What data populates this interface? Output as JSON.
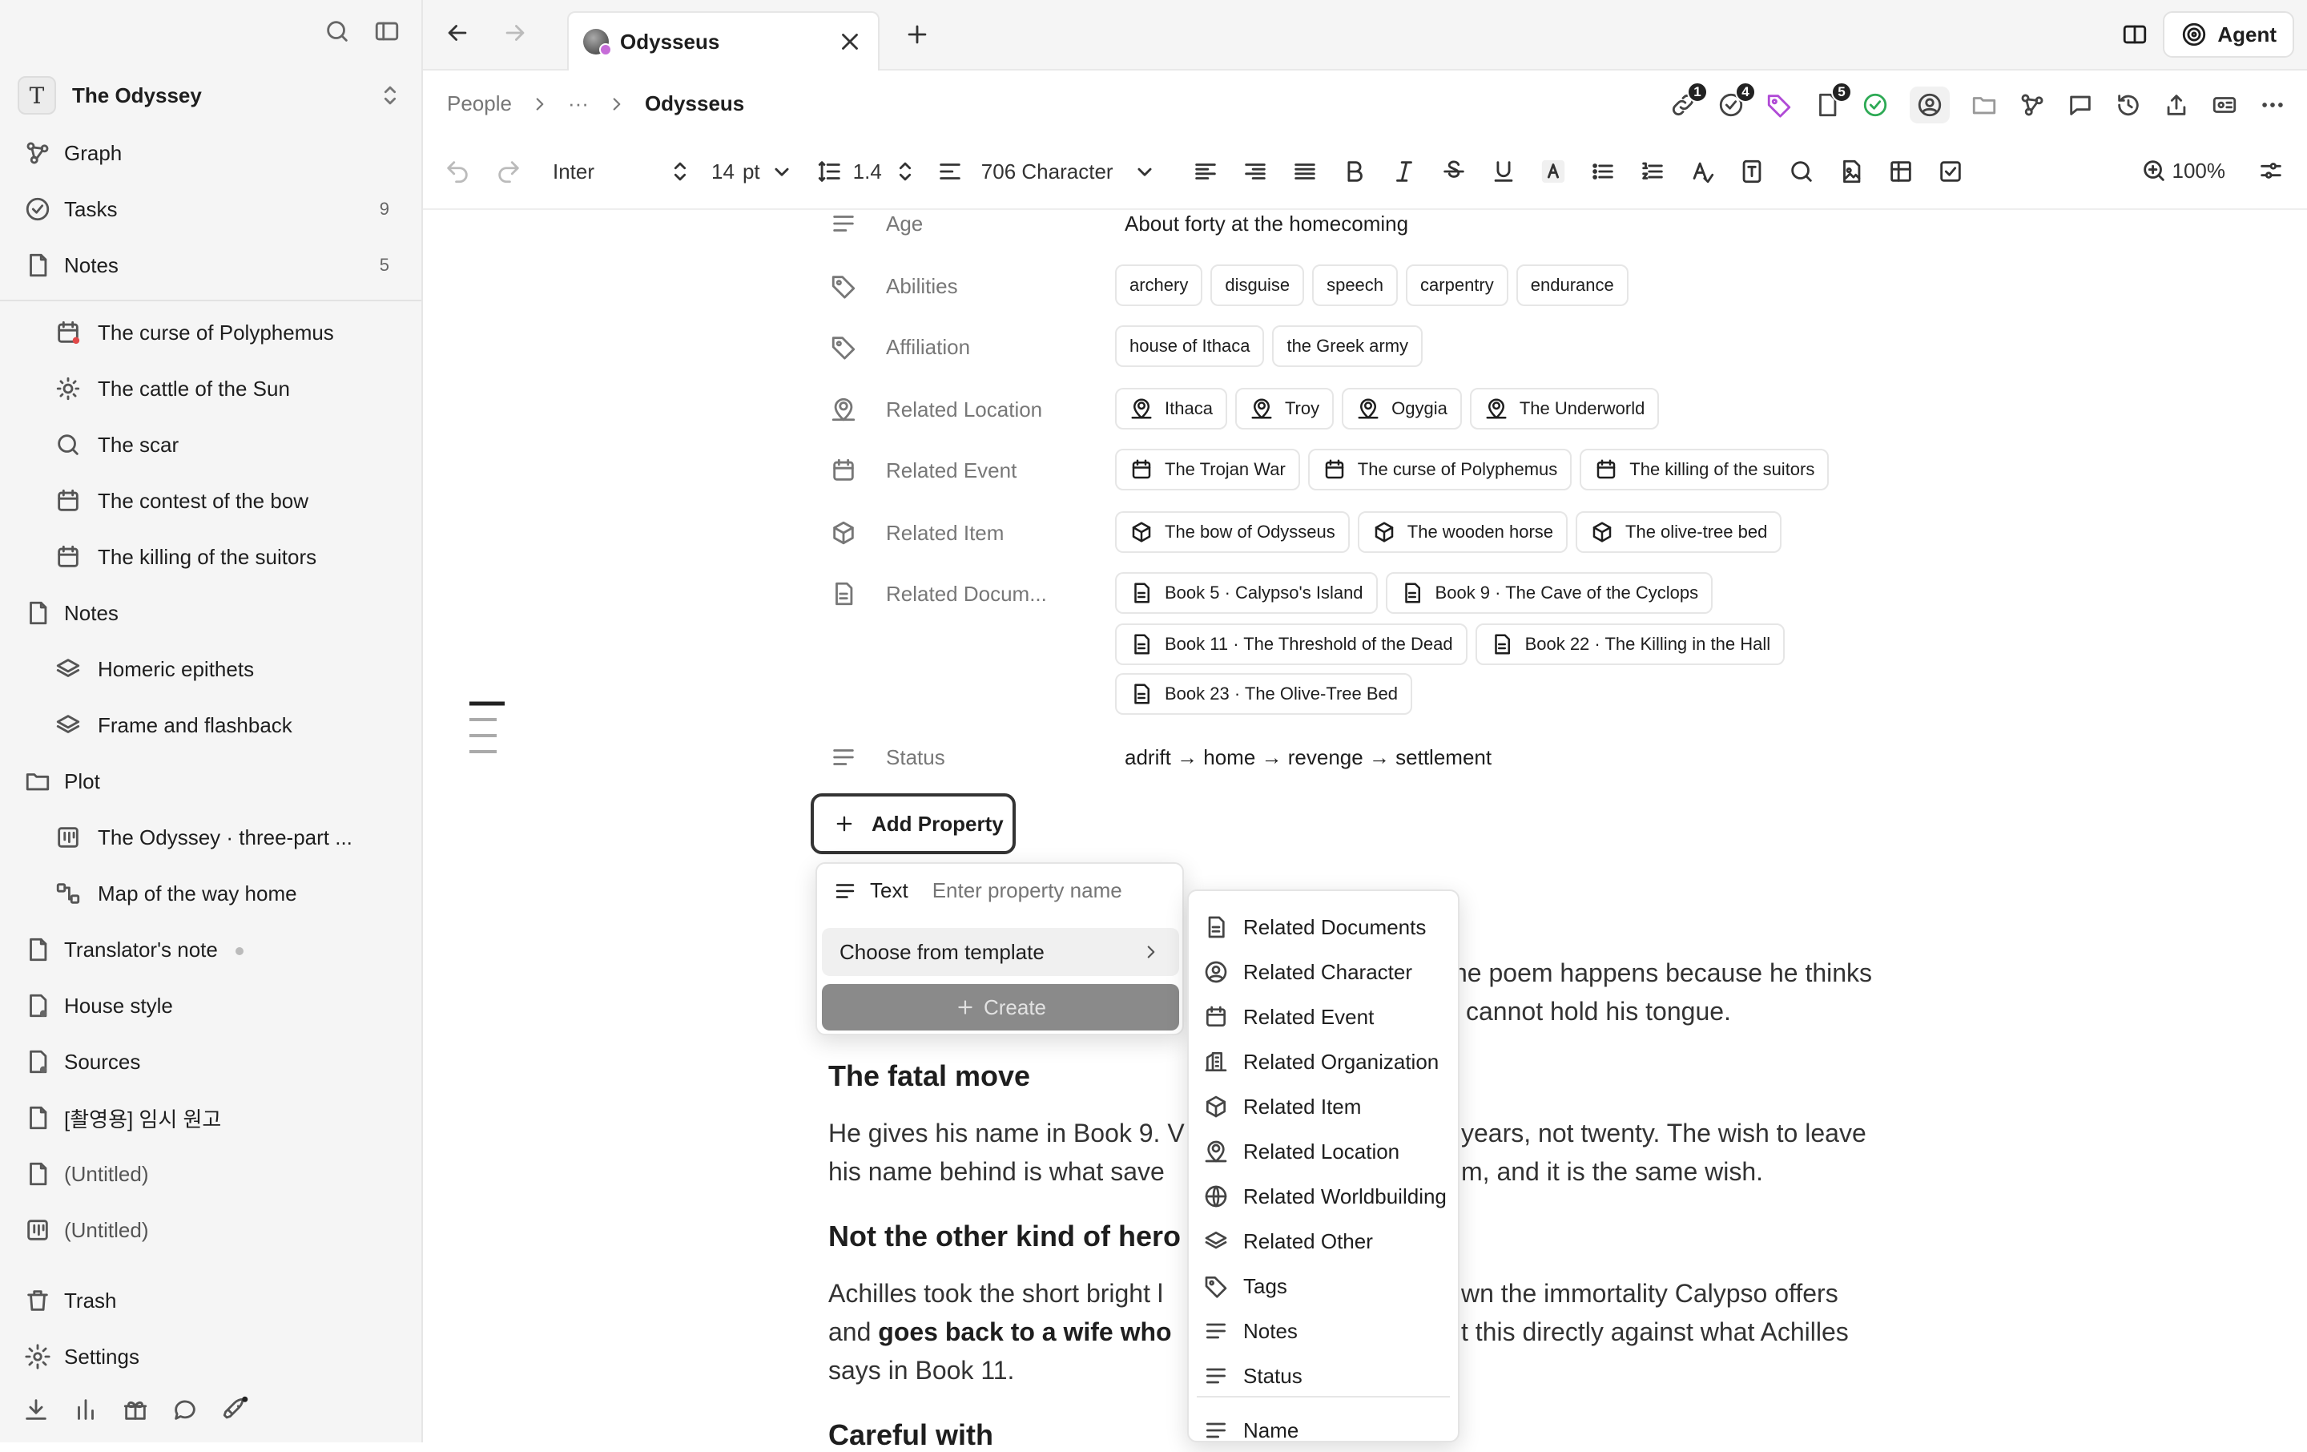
{
  "workspace": {
    "initial": "T",
    "name": "The Odyssey"
  },
  "sidebar": {
    "top": [
      {
        "label": "Graph",
        "icon": "graph-icon",
        "count": ""
      },
      {
        "label": "Tasks",
        "icon": "task-circle-icon",
        "count": "9"
      },
      {
        "label": "Notes",
        "icon": "page-icon",
        "count": "5"
      }
    ],
    "items": [
      {
        "label": "The curse of Polyphemus",
        "icon": "calendar-icon",
        "sub": true
      },
      {
        "label": "The cattle of the Sun",
        "icon": "sun-icon",
        "sub": true
      },
      {
        "label": "The scar",
        "icon": "search-icon",
        "sub": true
      },
      {
        "label": "The contest of the bow",
        "icon": "calendar-icon",
        "sub": true
      },
      {
        "label": "The killing of the suitors",
        "icon": "calendar-icon",
        "sub": true
      },
      {
        "label": "Notes",
        "icon": "page-icon",
        "sub": false
      },
      {
        "label": "Homeric epithets",
        "icon": "layers-icon",
        "sub": true
      },
      {
        "label": "Frame and flashback",
        "icon": "layers-icon",
        "sub": true
      },
      {
        "label": "Plot",
        "icon": "folder-icon",
        "sub": false
      },
      {
        "label": "The Odyssey · three-part ...",
        "icon": "board-icon",
        "sub": true
      },
      {
        "label": "Map of the way home",
        "icon": "map-icon",
        "sub": true
      },
      {
        "label": "Translator's note",
        "icon": "page-icon",
        "sub": false
      },
      {
        "label": "House style",
        "icon": "page-user-icon",
        "sub": false
      },
      {
        "label": "Sources",
        "icon": "page-user-icon",
        "sub": false
      },
      {
        "label": "[촬영용] 임시 원고",
        "icon": "page-icon",
        "sub": false
      },
      {
        "label": "(Untitled)",
        "icon": "page-icon",
        "sub": false
      },
      {
        "label": "(Untitled)",
        "icon": "board-icon",
        "sub": false
      }
    ],
    "trash": "Trash",
    "settings": "Settings"
  },
  "tab": {
    "title": "Odysseus"
  },
  "agent_label": "Agent",
  "breadcrumb": {
    "root": "People",
    "ellipsis": "···",
    "current": "Odysseus"
  },
  "badges": {
    "links": "1",
    "tasks": "4",
    "pages": "5"
  },
  "toolbar": {
    "font": "Inter",
    "size": "14",
    "unit": "pt",
    "line_height": "1.4",
    "template": "706 Character",
    "zoom": "100%"
  },
  "properties": {
    "age_label": "Age",
    "age_value": "About forty at the homecoming",
    "abilities_label": "Abilities",
    "abilities": [
      "archery",
      "disguise",
      "speech",
      "carpentry",
      "endurance"
    ],
    "affiliation_label": "Affiliation",
    "affiliations": [
      "house of Ithaca",
      "the Greek army"
    ],
    "location_label": "Related Location",
    "locations": [
      "Ithaca",
      "Troy",
      "Ogygia",
      "The Underworld"
    ],
    "event_label": "Related Event",
    "events": [
      "The Trojan War",
      "The curse of Polyphemus",
      "The killing of the suitors"
    ],
    "item_label": "Related Item",
    "items": [
      "The bow of Odysseus",
      "The wooden horse",
      "The olive-tree bed"
    ],
    "docs_label": "Related Docum...",
    "docs_row1": [
      "Book 5 · Calypso's Island",
      "Book 9 · The Cave of the Cyclops"
    ],
    "docs_row2": [
      "Book 11 · The Threshold of the Dead",
      "Book 22 · The Killing in the Hall"
    ],
    "docs_row3": [
      "Book 23 · The Olive-Tree Bed"
    ],
    "status_label": "Status",
    "status_value": "adrift → home → revenge → settlement",
    "add_label": "Add Property"
  },
  "body": {
    "p1a": "he poem happens because he thinks",
    "p1b": "cannot hold his tongue.",
    "h_fatal": "The fatal move",
    "p2a": "He gives his name in Book 9. V",
    "p2a_end": "years, not twenty. The wish to leave",
    "p2b": "his name behind is what save",
    "p2b_end": "m, and it is the same wish.",
    "h_hero": "Not the other kind of hero",
    "p3a": "Achilles took the short bright l",
    "p3a_end": "wn the immortality Calypso offers",
    "p3b_pre": "and ",
    "p3b_bold": "goes back to a wife who",
    "p3b_end": "t this directly against what Achilles",
    "p3c": "says in Book 11.",
    "h_careful": "Careful with"
  },
  "new_property": {
    "type": "Text",
    "placeholder": "Enter property name",
    "template": "Choose from template",
    "create": "Create"
  },
  "template_menu": [
    {
      "label": "Related Documents",
      "icon": "document-icon"
    },
    {
      "label": "Related Character",
      "icon": "person-icon"
    },
    {
      "label": "Related Event",
      "icon": "calendar-icon"
    },
    {
      "label": "Related Organization",
      "icon": "building-icon"
    },
    {
      "label": "Related Item",
      "icon": "cube-icon"
    },
    {
      "label": "Related Location",
      "icon": "location-person-icon"
    },
    {
      "label": "Related Worldbuilding",
      "icon": "globe-icon"
    },
    {
      "label": "Related Other",
      "icon": "layers-icon"
    },
    {
      "label": "Tags",
      "icon": "tag-icon"
    },
    {
      "label": "Notes",
      "icon": "lines-icon"
    },
    {
      "label": "Status",
      "icon": "lines-icon"
    },
    {
      "label": "Name",
      "icon": "lines-icon"
    }
  ]
}
